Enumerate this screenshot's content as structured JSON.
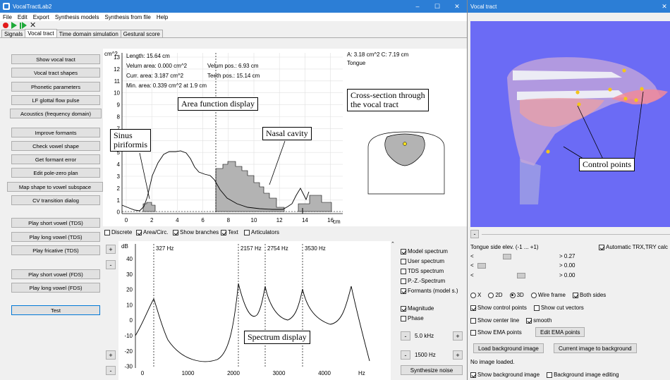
{
  "main_window": {
    "title": "VocalTractLab2",
    "controls": [
      "–",
      "☐",
      "✕"
    ],
    "menu": [
      "File",
      "Edit",
      "Export",
      "Synthesis models",
      "Synthesis from file",
      "Help"
    ],
    "tabs": [
      "Signals",
      "Vocal tract",
      "Time domain simulation",
      "Gestural score"
    ],
    "active_tab": "Vocal tract",
    "buttons_top": [
      "Show vocal tract",
      "Vocal tract shapes",
      "Phonetic parameters",
      "LF glottal flow pulse",
      "Acoustics (frequency domain)"
    ],
    "buttons_mid": [
      "Improve formants",
      "Check vowel shape",
      "Get formant error",
      "Edit pole-zero plan",
      "Map shape to vowel subspace",
      "CV transition dialog"
    ],
    "buttons_play_tds": [
      "Play short vowel (TDS)",
      "Play long vowel (TDS)",
      "Play fricative (TDS)"
    ],
    "buttons_play_fds": [
      "Play short vowel (FDS)",
      "Play long vowel (FDS)"
    ],
    "test_button": "Test"
  },
  "area_plot": {
    "unit_y": "cm^2",
    "unit_x": "cm",
    "info_left": [
      "Length: 15.64 cm",
      "Velum area: 0.000 cm^2",
      "Curr. area: 3.187 cm^2",
      "Min. area: 0.339 cm^2 at 1.9 cm"
    ],
    "info_mid": [
      "Velum pos.: 6.93 cm",
      "Teeth pos.: 15.14 cm"
    ],
    "info_right": [
      "A: 3.18 cm^2  C: 7.19 cm",
      "Tongue"
    ],
    "y_ticks": [
      "13",
      "12",
      "11",
      "10",
      "9",
      "8",
      "7",
      "6",
      "5",
      "4",
      "3",
      "2",
      "1",
      "0"
    ],
    "x_ticks": [
      "0",
      "2",
      "4",
      "6",
      "8",
      "10",
      "12",
      "14",
      "16"
    ],
    "options": [
      {
        "label": "Discrete",
        "checked": false
      },
      {
        "label": "Area/Circ.",
        "checked": true
      },
      {
        "label": "Show branches",
        "checked": true
      },
      {
        "label": "Text",
        "checked": true
      },
      {
        "label": "Articulators",
        "checked": false
      }
    ]
  },
  "spectrum_plot": {
    "unit_y": "dB",
    "unit_x": "Hz",
    "y_ticks": [
      "40",
      "30",
      "20",
      "10",
      "0",
      "-10",
      "-20",
      "-30"
    ],
    "x_ticks": [
      "0",
      "1000",
      "2000",
      "3000",
      "4000"
    ],
    "formant_labels": [
      "327 Hz",
      "2157 Hz",
      "2754 Hz",
      "3530 Hz"
    ],
    "options": [
      {
        "label": "Model spectrum",
        "checked": true
      },
      {
        "label": "User spectrum",
        "checked": false
      },
      {
        "label": "TDS spectrum",
        "checked": false
      },
      {
        "label": "P.-Z.-Spectrum",
        "checked": false
      },
      {
        "label": "Formants (model s.)",
        "checked": true
      }
    ],
    "options2": [
      {
        "label": "Magnitude",
        "checked": true
      },
      {
        "label": "Phase",
        "checked": false
      }
    ],
    "freq_range": "5.0 kHz",
    "ref_freq": "1500 Hz",
    "synth_noise": "Synthesize noise",
    "plus": "+",
    "minus": "-"
  },
  "callouts": {
    "area_function": "Area function display",
    "cross_section": "Cross-section through\nthe vocal tract",
    "sinus": "Sinus\npiriformis",
    "nasal": "Nasal cavity",
    "spectrum": "Spectrum display",
    "control_points": "Control points"
  },
  "vt_window": {
    "title": "Vocal tract",
    "close": "✕",
    "collapse": "-",
    "param_label": "Tongue side elev. (-1 ... +1)",
    "auto_label": "Automatic TRX,TRY calc",
    "sliders": [
      {
        "value": "> 0.27"
      },
      {
        "value": "> 0.00"
      },
      {
        "value": "> 0.00"
      }
    ],
    "slider_left": "<",
    "view_options": [
      {
        "label": "X",
        "selected": false
      },
      {
        "label": "2D",
        "selected": false
      },
      {
        "label": "3D",
        "selected": true
      },
      {
        "label": "Wire frame",
        "selected": false
      }
    ],
    "both_sides": "Both sides",
    "show_control_points": "Show control points",
    "show_cut_vectors": "Show cut vectors",
    "show_center_line": "Show center line",
    "smooth": "smooth",
    "show_ema_points": "Show EMA points",
    "edit_ema_points": "Edit EMA points",
    "load_bg": "Load background image",
    "current_bg": "Current image to background",
    "no_image": "No image loaded.",
    "show_bg": "Show background image",
    "bg_editing": "Background image editing"
  },
  "colors": {
    "titlebar": "#2c7ed6",
    "vt_background": "#6b6bf5",
    "area_fill": "#b3b3b3",
    "record": "#e21b1b",
    "play": "#1faa3a"
  }
}
